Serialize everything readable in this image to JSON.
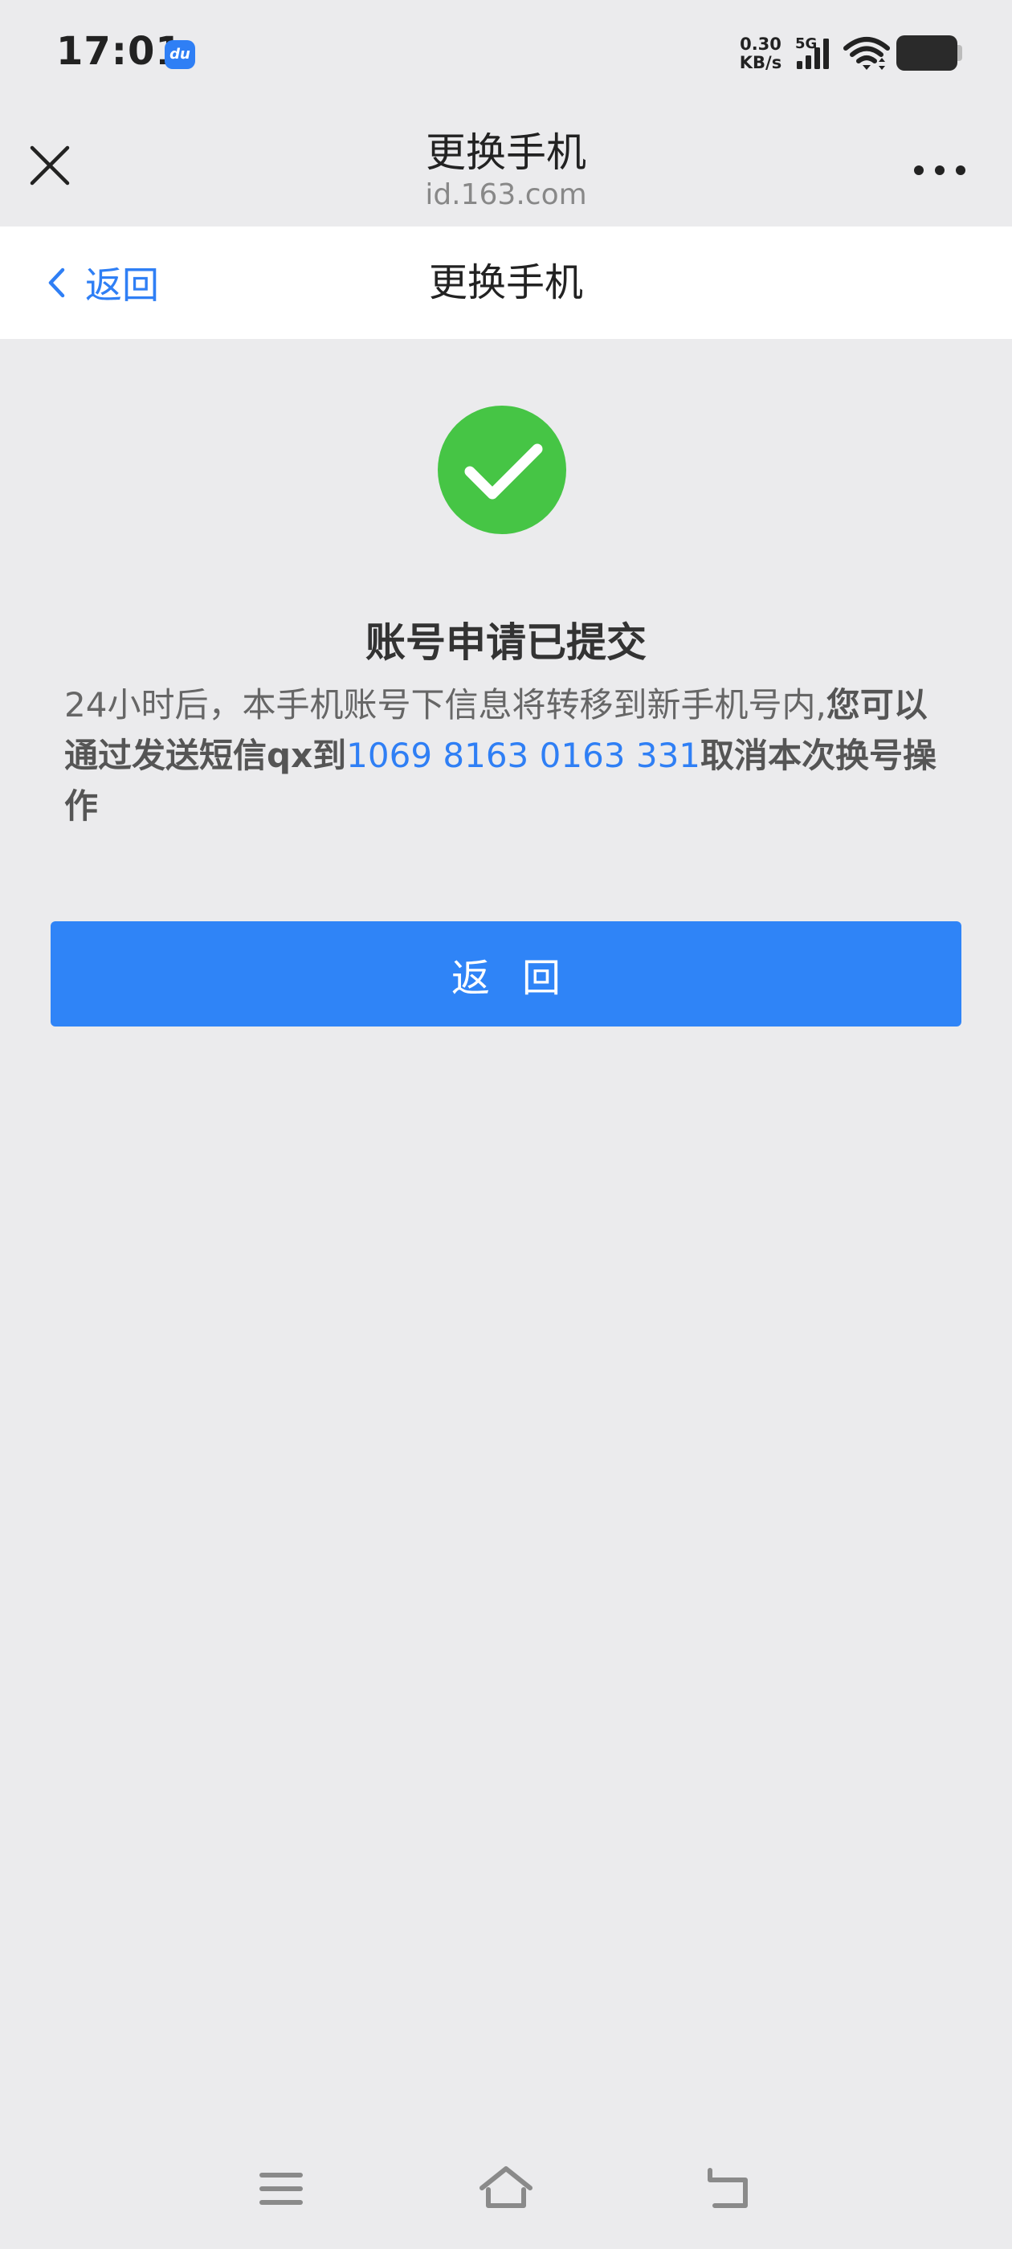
{
  "status_bar": {
    "time": "17:01",
    "app_icon_label": "du",
    "net_speed_value": "0.30",
    "net_speed_unit": "KB/s",
    "signal_label": "5G",
    "icons": [
      "signal-icon",
      "wifi-icon",
      "battery-icon"
    ]
  },
  "browser": {
    "title": "更换手机",
    "domain": "id.163.com",
    "icons": [
      "close-icon",
      "more-icon"
    ]
  },
  "page_nav": {
    "back_label": "返回",
    "title": "更换手机"
  },
  "content": {
    "status_title": "账号申请已提交",
    "message_normal": "24小时后，本手机账号下信息将转移到新手机号内,",
    "message_bold_1": "您可以通过发送短信qx到",
    "message_phone": "1069 8163 0163 331",
    "message_bold_2": "取消本次换号操作",
    "return_button": "返回"
  },
  "colors": {
    "accent": "#2f7ff5",
    "button": "#2f84f7",
    "success": "#46c545",
    "background": "#ebebed"
  },
  "system_nav": {
    "icons": [
      "menu-icon",
      "home-icon",
      "back-icon"
    ]
  }
}
